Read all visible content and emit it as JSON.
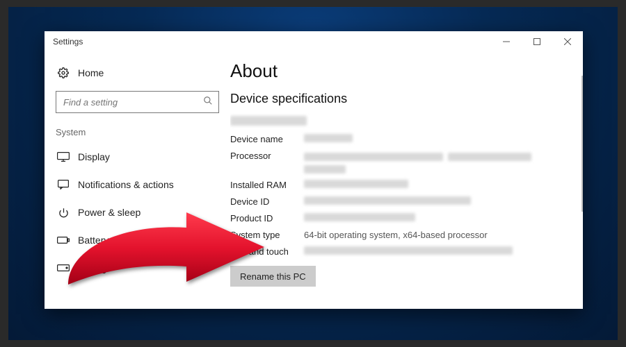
{
  "window": {
    "title": "Settings"
  },
  "sidebar": {
    "home_label": "Home",
    "search_placeholder": "Find a setting",
    "category": "System",
    "items": [
      {
        "label": "Display"
      },
      {
        "label": "Notifications & actions"
      },
      {
        "label": "Power & sleep"
      },
      {
        "label": "Battery"
      },
      {
        "label": "Storage"
      }
    ]
  },
  "main": {
    "heading": "About",
    "subheading": "Device specifications",
    "rows": [
      {
        "label": "Device name"
      },
      {
        "label": "Processor"
      },
      {
        "label": "Installed RAM"
      },
      {
        "label": "Device ID"
      },
      {
        "label": "Product ID"
      },
      {
        "label": "System type",
        "value": "64-bit operating system, x64-based processor"
      },
      {
        "label": "Pen and touch"
      }
    ],
    "rename_btn": "Rename this PC"
  },
  "annotation": {
    "arrow_color": "#d4152a"
  }
}
